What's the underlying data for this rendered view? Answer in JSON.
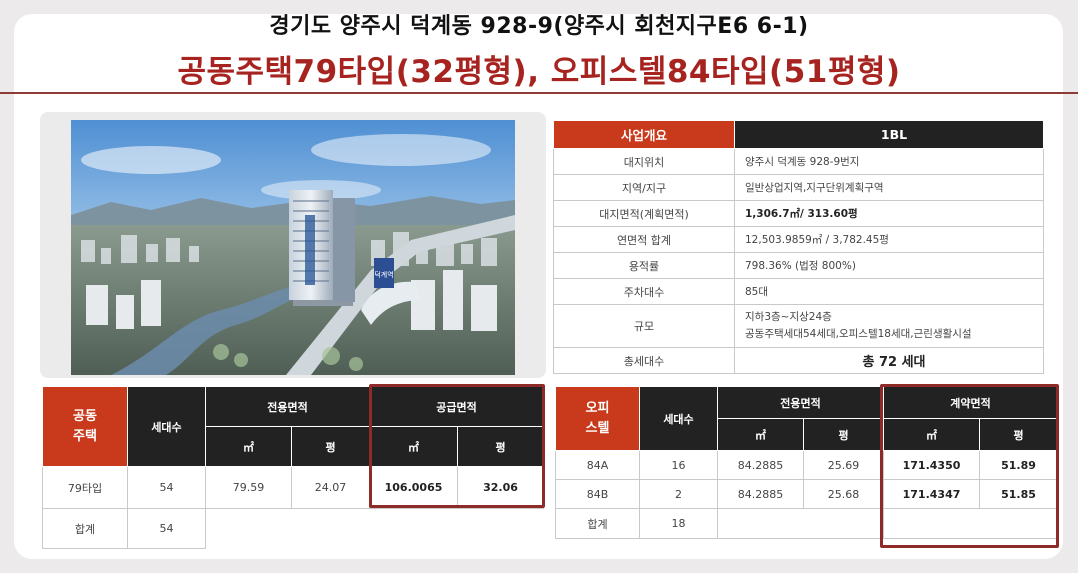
{
  "header": {
    "address_line": "경기도 양주시 덕계동 928-9(양주시 회천지구E6 6-1)",
    "headline": "공동주택79타입(32평형), 오피스텔84타입(51평형)"
  },
  "overview": {
    "header": {
      "key": "사업개요",
      "value": "1BL"
    },
    "rows": [
      {
        "key": "대지위치",
        "value": "양주시 덕계동 928-9번지"
      },
      {
        "key": "지역/지구",
        "value": "일반상업지역,지구단위계획구역"
      },
      {
        "key": "대지면적(계획면적)",
        "value": "1,306.7㎡/ 313.60평"
      },
      {
        "key": "연면적 합계",
        "value": "12,503.9859㎡ / 3,782.45평"
      },
      {
        "key": "용적률",
        "value": "798.36% (법정 800%)"
      },
      {
        "key": "주차대수",
        "value": "85대"
      },
      {
        "key": "규모",
        "value_lines": [
          "지하3층~지상24층",
          "공동주택세대54세대,오피스텔18세대,근린생활시설"
        ]
      },
      {
        "key": "총세대수",
        "value": "총 72 세대"
      }
    ]
  },
  "apartment_table": {
    "category_lines": [
      "공동",
      "주택"
    ],
    "units_label": "세대수",
    "exclusive_area_label": "전용면적",
    "supply_area_label": "공급면적",
    "sqm_label": "㎡",
    "pyeong_label": "평",
    "rows": [
      {
        "type": "79타입",
        "units": "54",
        "exclusive_sqm": "79.59",
        "exclusive_pyeong": "24.07",
        "supply_sqm": "106.0065",
        "supply_pyeong": "32.06"
      }
    ],
    "total": {
      "label": "합계",
      "units": "54"
    }
  },
  "officetel_table": {
    "category_lines": [
      "오피",
      "스텔"
    ],
    "units_label": "세대수",
    "exclusive_area_label": "전용면적",
    "contract_area_label": "계약면적",
    "sqm_label": "㎡",
    "pyeong_label": "평",
    "rows": [
      {
        "type": "84A",
        "units": "16",
        "exclusive_sqm": "84.2885",
        "exclusive_pyeong": "25.69",
        "contract_sqm": "171.4350",
        "contract_pyeong": "51.89"
      },
      {
        "type": "84B",
        "units": "2",
        "exclusive_sqm": "84.2885",
        "exclusive_pyeong": "25.68",
        "contract_sqm": "171.4347",
        "contract_pyeong": "51.85"
      }
    ],
    "total": {
      "label": "합계",
      "units": "18"
    }
  },
  "building_sign": "덕계역",
  "colors": {
    "accent_red": "#c9391c",
    "headline_red": "#a7231f",
    "header_dark": "#222222",
    "highlight_border": "#8e2a28"
  }
}
